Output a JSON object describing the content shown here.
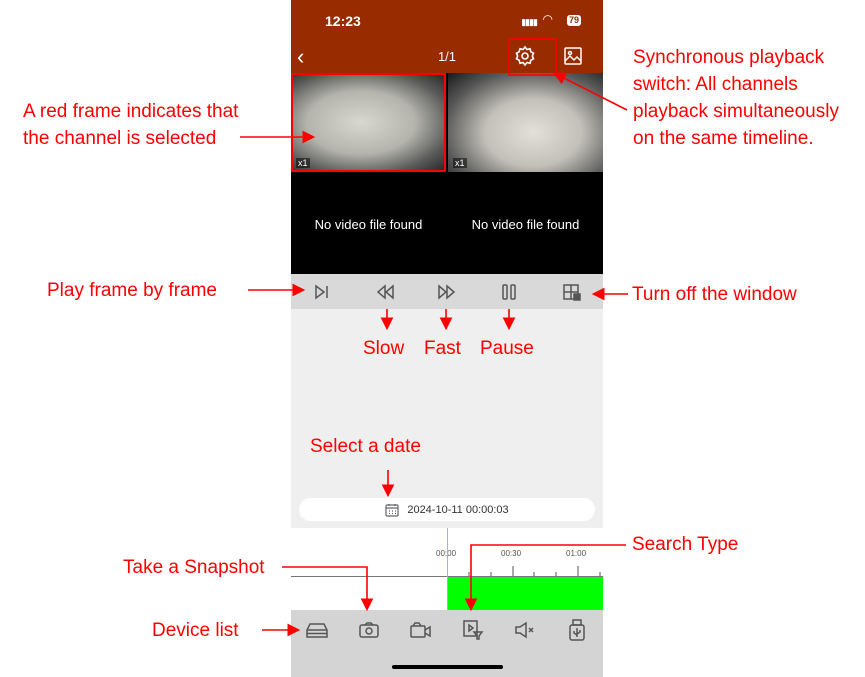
{
  "status": {
    "time": "12:23",
    "battery": "79"
  },
  "nav": {
    "title": "1/1",
    "back_icon": "chevron-left-icon",
    "settings_icon": "gear-icon",
    "gallery_icon": "image-icon"
  },
  "channels": [
    {
      "speed": "x1",
      "selected": true
    },
    {
      "speed": "x1",
      "selected": false
    },
    {
      "message": "No video file found"
    },
    {
      "message": "No video file found"
    }
  ],
  "controls": [
    "frame-step-icon",
    "slow-icon",
    "fast-icon",
    "pause-icon",
    "window-off-icon"
  ],
  "date": {
    "value": "2024-10-11 00:00:03",
    "icon": "calendar-icon"
  },
  "timeline": {
    "ticks": [
      "00:00",
      "00:30",
      "01:00"
    ],
    "recording_color": "#00ff00"
  },
  "bottom_bar": [
    "device-list-icon",
    "camera-icon",
    "video-record-icon",
    "search-type-icon",
    "mute-icon",
    "usb-icon"
  ],
  "annotations": {
    "selected": "A red frame indicates that the channel is selected",
    "sync": "Synchronous playback switch: All channels playback simultaneously on the same timeline.",
    "frame": "Play frame by frame",
    "window": "Turn off the window",
    "slow": "Slow",
    "fast": "Fast",
    "pause": "Pause",
    "date": "Select a date",
    "snapshot": "Take a Snapshot",
    "search": "Search Type",
    "device": "Device list"
  },
  "colors": {
    "header": "#982b00",
    "annotation": "#ff0000"
  }
}
